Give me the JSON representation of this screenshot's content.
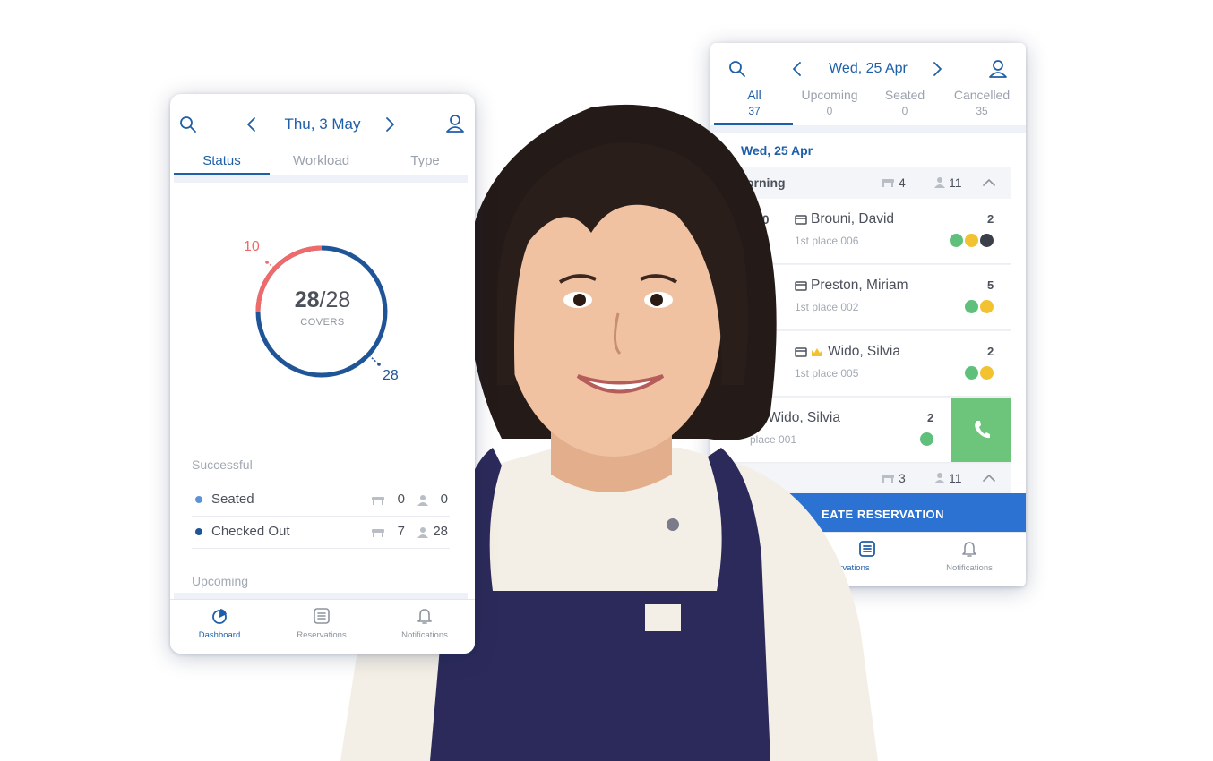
{
  "left_phone": {
    "date": "Thu, 3 May",
    "tabs": [
      "Status",
      "Workload",
      "Type"
    ],
    "chart": {
      "center_value": "28",
      "center_total": "/28",
      "center_label": "COVERS",
      "label_a": "10",
      "label_b": "28",
      "color_a": "#f06a6a",
      "color_b": "#1f5497"
    },
    "section_successful": "Successful",
    "rows": [
      {
        "label": "Seated",
        "tables": "0",
        "covers": "0",
        "dot": "#5c93d6"
      },
      {
        "label": "Checked Out",
        "tables": "7",
        "covers": "28",
        "dot": "#1f5497"
      }
    ],
    "section_upcoming": "Upcoming",
    "nav": [
      "Dashboard",
      "Reservations",
      "Notifications"
    ]
  },
  "right_phone": {
    "date": "Wed, 25 Apr",
    "tabs": [
      {
        "label": "All",
        "count": "37"
      },
      {
        "label": "Upcoming",
        "count": "0"
      },
      {
        "label": "Seated",
        "count": "0"
      },
      {
        "label": "Cancelled",
        "count": "35"
      }
    ],
    "list_date": "Wed, 25 Apr",
    "group1": {
      "label": "orning",
      "tables": "4",
      "covers": "11"
    },
    "reservations": [
      {
        "time": "00",
        "time2": "00",
        "name": "Brouni, David",
        "place": "1st place 006",
        "size": "2"
      },
      {
        "time": "0",
        "name": "Preston, Miriam",
        "place": "1st place 002",
        "size": "5"
      },
      {
        "name": "Wido, Silvia",
        "place": "1st place 005",
        "size": "2"
      },
      {
        "name": "Wido, Silvia",
        "place": "place 001",
        "size": "2"
      }
    ],
    "group2": {
      "tables": "3",
      "covers": "11"
    },
    "cta": "EATE RESERVATION",
    "nav": [
      "rvations",
      "Notifications"
    ]
  },
  "colors": {
    "accent": "#1f5fa8",
    "call_green": "#6cc57a",
    "cta_blue": "#2b72d2"
  }
}
